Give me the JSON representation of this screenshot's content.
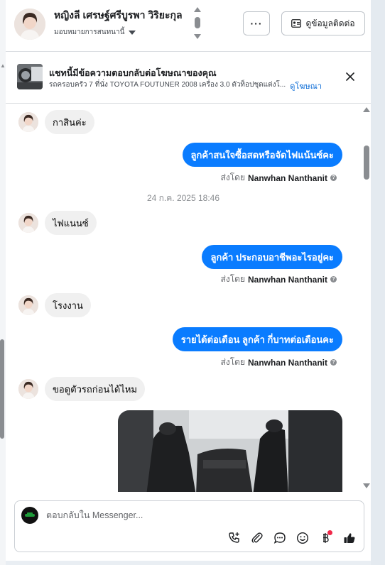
{
  "header": {
    "contact_name": "หญิงลี เศรษฐ์ศรีบูรพา วิริยะกุล",
    "assign_label": "มอบหมายการสนทนานี้",
    "more_label": "···",
    "contact_info_label": "ดูข้อมูลติดต่อ"
  },
  "ad_banner": {
    "title": "แชทนี้มีข้อความตอบกลับต่อโฆษณาของคุณ",
    "subtitle": "รถครอบครัว 7 ที่นั่ง TOYOTA FOUTUNER 2008 เครื่อง 3.0 ตัวท็อปชุดแต่งโ...",
    "view_ad_label": "ดูโฆษณา"
  },
  "thread": {
    "messages": [
      {
        "id": "m1",
        "direction": "in",
        "text": "กาสินค่ะ"
      },
      {
        "id": "m2",
        "direction": "out",
        "text": "ลูกค้าสนใจซื้อสดหรือจัดไฟแน้นซ์คะ",
        "sent_by_prefix": "ส่งโดย",
        "sent_by_name": "Nanwhan Nanthanit"
      },
      {
        "id": "m3",
        "direction": "in",
        "text": "ไฟแนนซ์"
      },
      {
        "id": "m4",
        "direction": "out",
        "text": "ลูกค้า ประกอบอาชีพอะไรอยู่คะ",
        "sent_by_prefix": "ส่งโดย",
        "sent_by_name": "Nanwhan Nanthanit"
      },
      {
        "id": "m5",
        "direction": "in",
        "text": "โรงงาน"
      },
      {
        "id": "m6",
        "direction": "out",
        "text": "รายได้ต่อเดือน  ลูกค้า กี่บาทต่อเดือนคะ",
        "sent_by_prefix": "ส่งโดย",
        "sent_by_name": "Nanwhan Nanthanit"
      },
      {
        "id": "m7",
        "direction": "in",
        "text": "ขอดูตัวรถก่อนได้ไหม"
      }
    ],
    "timestamp": "24 ก.ค. 2025 18:46"
  },
  "composer": {
    "placeholder": "ตอบกลับใน Messenger..."
  },
  "icons": {
    "avatar": "avatar-woman",
    "ad_thumbnail": "car-interior",
    "close": "close-icon",
    "info": "question-icon",
    "tools": [
      "call-add-icon",
      "attachment-icon",
      "saved-reply-icon",
      "emoji-icon",
      "payment-icon",
      "like-icon"
    ]
  },
  "colors": {
    "accent": "#0a7cff",
    "link": "#0a6bd6",
    "notification": "#f02849"
  }
}
